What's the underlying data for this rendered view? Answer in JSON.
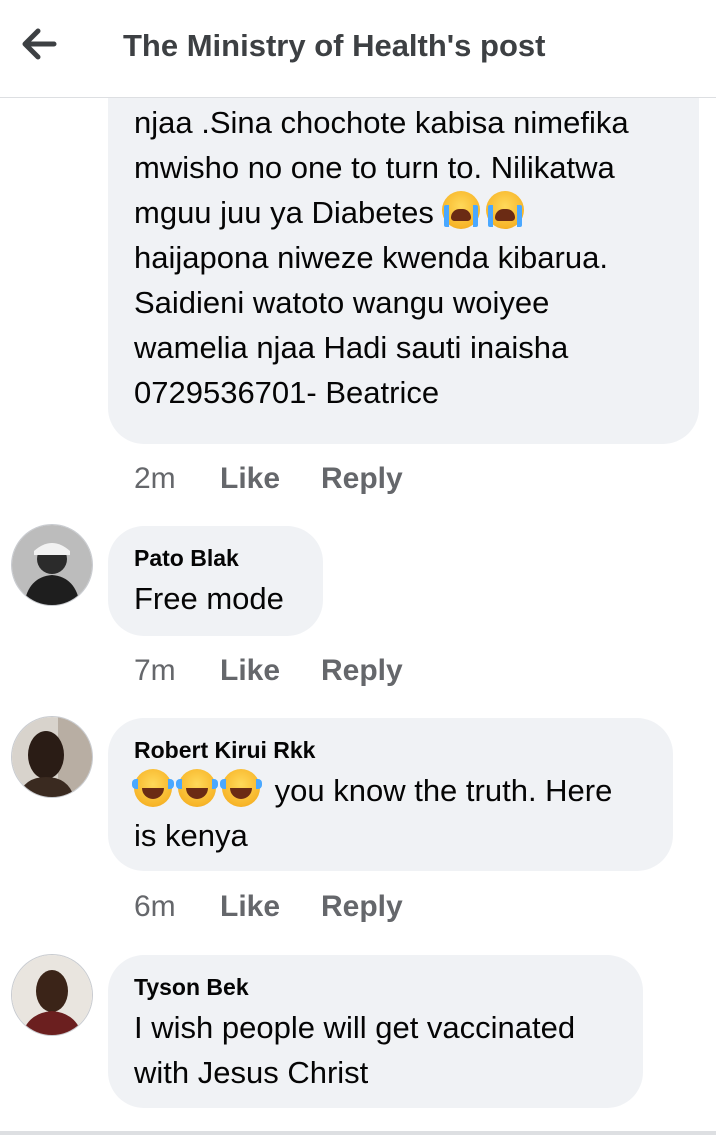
{
  "header": {
    "title": "The Ministry of Health's post",
    "back_icon": "back-arrow-icon"
  },
  "comments": [
    {
      "partial": true,
      "text_lines": [
        "njaa .Sina chochote kabisa nimefika",
        "mwisho no one to turn to. Nilikatwa",
        "mguu juu ya Diabetes",
        "haijapona niweze kwenda kibarua.",
        "Saidieni watoto wangu woiyee",
        "wamelia njaa Hadi sauti inaisha",
        "0729536701- Beatrice"
      ],
      "time": "2m",
      "like": "Like",
      "reply": "Reply"
    },
    {
      "author": "Pato Blak",
      "text": "Free mode",
      "time": "7m",
      "like": "Like",
      "reply": "Reply"
    },
    {
      "author": "Robert Kirui Rkk",
      "text_line1": "you know the truth. Here",
      "text_line2": "is kenya",
      "time": "6m",
      "like": "Like",
      "reply": "Reply"
    },
    {
      "author": "Tyson Bek",
      "text_line1": "I wish people will get vaccinated",
      "text_line2": "with Jesus Christ"
    }
  ],
  "colors": {
    "bubble": "#f0f2f5",
    "meta_text": "#65676b",
    "title_text": "#3d4043"
  }
}
